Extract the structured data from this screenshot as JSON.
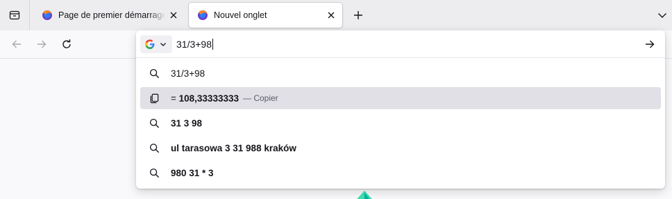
{
  "tabs": [
    {
      "title": "Page de premier démarrage de",
      "active": false
    },
    {
      "title": "Nouvel onglet",
      "active": true
    }
  ],
  "urlbar": {
    "value": "31/3+98",
    "search_engine_icon": "google-g-icon"
  },
  "results": [
    {
      "icon": "search-icon",
      "prefix": "",
      "bold": "",
      "plain": "31/3+98",
      "action": ""
    },
    {
      "icon": "copy-icon",
      "prefix": "= ",
      "bold": "108,33333333",
      "plain": "",
      "action": "— Copier"
    },
    {
      "icon": "search-icon",
      "prefix": "",
      "bold": "31 3 98",
      "plain": "",
      "action": ""
    },
    {
      "icon": "search-icon",
      "prefix": "",
      "bold": "ul tarasowa 3 31 988 kraków",
      "plain": "",
      "action": ""
    },
    {
      "icon": "search-icon",
      "prefix": "",
      "bold": "980 31 * 3",
      "plain": "",
      "action": ""
    }
  ],
  "colors": {
    "tabstrip": "#ededf0",
    "selected_row": "#e0e0e6",
    "firefox_accent": "#0a84ff"
  }
}
